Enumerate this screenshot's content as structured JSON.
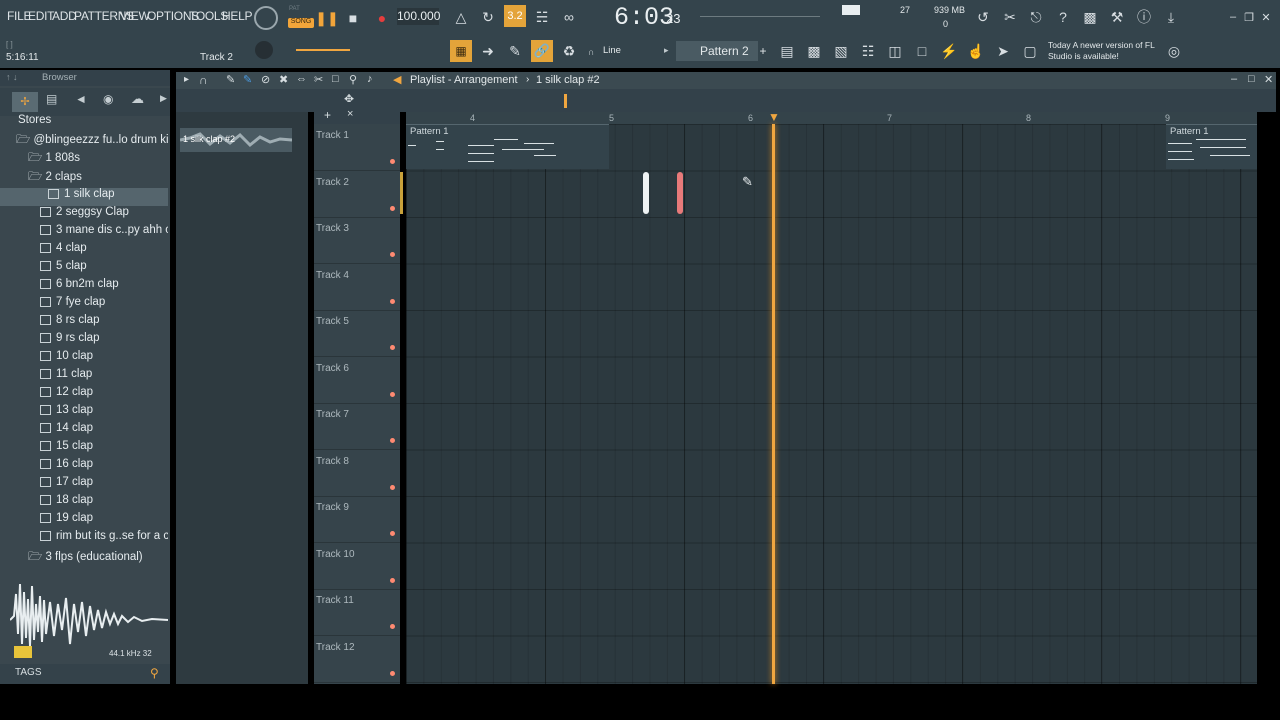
{
  "menu": [
    "FILE",
    "EDIT",
    "ADD",
    "PATTERNS",
    "VIEW",
    "OPTIONS",
    "TOOLS",
    "HELP"
  ],
  "transport": {
    "mode_pat": "PAT",
    "mode_song": "SONG",
    "tempo": "100.000",
    "time": "6:03",
    "time_ms": "23",
    "snap": "3.2"
  },
  "memory": {
    "cpu": "27",
    "ram": "939 MB",
    "voices": "0"
  },
  "hint": {
    "position": "5:16:11",
    "track": "Track 2"
  },
  "tools": {
    "line_mode": "Line",
    "pattern": "Pattern 2",
    "news_date": "Today",
    "news_text": "A newer version of FL Studio is available!"
  },
  "browser": {
    "title": "Browser",
    "tags": "TAGS",
    "sample_info": "44.1 kHz 32",
    "items": [
      {
        "label": "Stores",
        "level": 0
      },
      {
        "label": "@blingeezzz fu..lo drum kit 2",
        "level": 0
      },
      {
        "label": "1 808s",
        "level": 1
      },
      {
        "label": "2 claps",
        "level": 1
      },
      {
        "label": "1 silk clap",
        "level": 2
      },
      {
        "label": "2  seggsy Clap",
        "level": 2
      },
      {
        "label": "3 mane dis c..py ahh clap",
        "level": 2
      },
      {
        "label": "4 clap",
        "level": 2
      },
      {
        "label": "5 clap",
        "level": 2
      },
      {
        "label": "6 bn2m clap",
        "level": 2
      },
      {
        "label": "7 fye clap",
        "level": 2
      },
      {
        "label": "8 rs clap",
        "level": 2
      },
      {
        "label": "9 rs clap",
        "level": 2
      },
      {
        "label": "10 clap",
        "level": 2
      },
      {
        "label": "11 clap",
        "level": 2
      },
      {
        "label": "12 clap",
        "level": 2
      },
      {
        "label": "13 clap",
        "level": 2
      },
      {
        "label": "14 clap",
        "level": 2
      },
      {
        "label": "15 clap",
        "level": 2
      },
      {
        "label": "16 clap",
        "level": 2
      },
      {
        "label": "17 clap",
        "level": 2
      },
      {
        "label": "18 clap",
        "level": 2
      },
      {
        "label": "19 clap",
        "level": 2
      },
      {
        "label": "rim but its g..se for a clap",
        "level": 2
      },
      {
        "label": "3 flps (educational)",
        "level": 1
      }
    ]
  },
  "picker": {
    "item": "1 silk clap #2"
  },
  "playlist": {
    "title": "Playlist - Arrangement",
    "breadcrumb": "1 silk clap #2",
    "ruler": [
      "4",
      "5",
      "6",
      "7",
      "8",
      "9"
    ],
    "tracks": [
      "Track 1",
      "Track 2",
      "Track 3",
      "Track 4",
      "Track 5",
      "Track 6",
      "Track 7",
      "Track 8",
      "Track 9",
      "Track 10",
      "Track 11",
      "Track 12"
    ],
    "clips": [
      {
        "label": "Pattern 1"
      },
      {
        "label": "Pattern 1"
      }
    ]
  }
}
